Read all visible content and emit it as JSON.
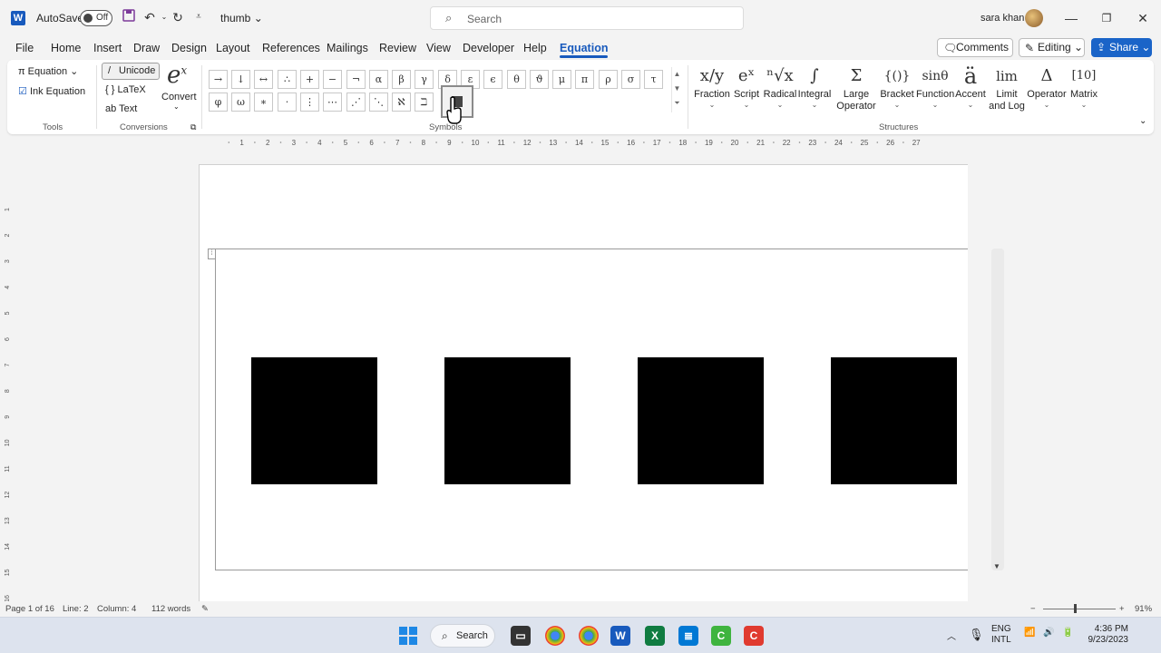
{
  "titlebar": {
    "autosave_label": "AutoSave",
    "autosave_state": "Off",
    "doc_title": "thumb",
    "search_placeholder": "Search",
    "user_name": "sara khan",
    "window_controls": [
      "minimize-icon",
      "restore-icon",
      "close-icon"
    ]
  },
  "menu": {
    "items": [
      "File",
      "Home",
      "Insert",
      "Draw",
      "Design",
      "Layout",
      "References",
      "Mailings",
      "Review",
      "View",
      "Developer",
      "Help",
      "Equation"
    ],
    "active": "Equation",
    "comments_label": "Comments",
    "editing_label": "Editing",
    "share_label": "Share"
  },
  "ribbon": {
    "tools": {
      "equation_label": "Equation",
      "ink_equation_label": "Ink Equation",
      "group_label": "Tools"
    },
    "conversions": {
      "unicode_label": "Unicode",
      "latex_label": "LaTeX",
      "text_label": "Text",
      "convert_label": "Convert",
      "group_label": "Conversions"
    },
    "symbols": {
      "row1": [
        "→",
        "↓",
        "↔",
        "∴",
        "+",
        "−",
        "¬",
        "α",
        "β",
        "γ",
        "δ",
        "ε",
        "ϵ",
        "θ",
        "ϑ",
        "μ",
        "π",
        "ρ",
        "σ",
        "τ"
      ],
      "row2": [
        "φ",
        "ω",
        "∗",
        "·",
        "⋮",
        "⋯",
        "⋰",
        "⋱",
        "ℵ",
        "ℶ"
      ],
      "group_label": "Symbols"
    },
    "structures": {
      "items": [
        {
          "label": "Fraction",
          "glyph": "x/y"
        },
        {
          "label": "Script",
          "glyph": "eˣ"
        },
        {
          "label": "Radical",
          "glyph": "ⁿ√x"
        },
        {
          "label": "Integral",
          "glyph": "∫"
        },
        {
          "label": "Large Operator",
          "glyph": "Σ"
        },
        {
          "label": "Bracket",
          "glyph": "{()}"
        },
        {
          "label": "Function",
          "glyph": "sinθ"
        },
        {
          "label": "Accent",
          "glyph": "ä"
        },
        {
          "label": "Limit and Log",
          "glyph": "lim"
        },
        {
          "label": "Operator",
          "glyph": "Δ"
        },
        {
          "label": "Matrix",
          "glyph": "[10]"
        }
      ],
      "group_label": "Structures"
    }
  },
  "ruler": {
    "h_ticks": [
      "1",
      "2",
      "3",
      "4",
      "5",
      "6",
      "7",
      "8",
      "9",
      "10",
      "11",
      "12",
      "13",
      "14",
      "15",
      "16",
      "17",
      "18",
      "19",
      "20",
      "21",
      "22",
      "23",
      "24",
      "25",
      "26",
      "27"
    ],
    "v_ticks": [
      "1",
      "2",
      "3",
      "4",
      "5",
      "6",
      "7",
      "8",
      "9",
      "10",
      "11",
      "12",
      "13",
      "14",
      "15",
      "16"
    ]
  },
  "document": {
    "squares": [
      {
        "color": "#000000"
      },
      {
        "color": "#000000"
      },
      {
        "color": "#000000"
      },
      {
        "color": "#000000"
      }
    ]
  },
  "status": {
    "page": "Page 1 of 16",
    "line": "Line: 2",
    "column": "Column: 4",
    "words": "112 words",
    "zoom": "91%"
  },
  "taskbar": {
    "search_label": "Search",
    "lang_line1": "ENG",
    "lang_line2": "INTL",
    "time": "4:36 PM",
    "date": "9/23/2023"
  },
  "colors": {
    "accent": "#185abd",
    "share": "#1a64c8",
    "excel": "#107c41",
    "camtasia_green": "#3fb43f",
    "camtasia_red": "#e03a2f"
  }
}
